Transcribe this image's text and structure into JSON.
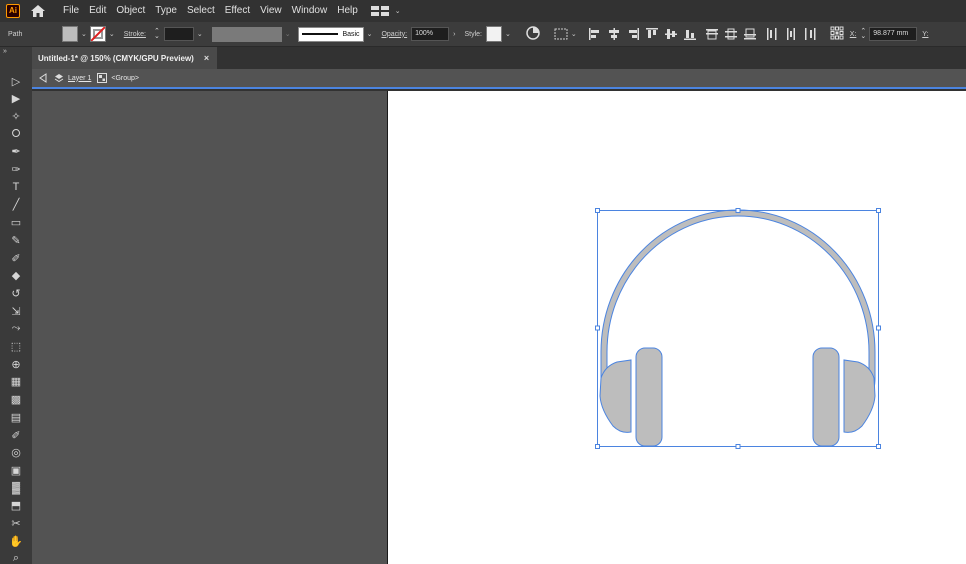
{
  "app": {
    "logo": "Ai"
  },
  "menu": [
    "File",
    "Edit",
    "Object",
    "Type",
    "Select",
    "Effect",
    "View",
    "Window",
    "Help"
  ],
  "control": {
    "selection_type": "Path",
    "stroke_label": "Stroke:",
    "brush_label": "Basic",
    "opacity_label": "Opacity:",
    "opacity_value": "100%",
    "style_label": "Style:",
    "x_label": "X:",
    "x_value": "98.877 mm",
    "y_label": "Y:"
  },
  "document": {
    "tab_title": "Untitled-1* @ 150% (CMYK/GPU Preview)",
    "close_glyph": "×"
  },
  "breadcrumb": {
    "layer": "Layer 1",
    "group": "<Group>"
  },
  "colors": {
    "fill": "#bdbdbd",
    "selection": "#4b84e0",
    "artboard": "#ffffff",
    "pasteboard": "#535353"
  },
  "tools": [
    "selection-tool-icon",
    "direct-selection-tool-icon",
    "magic-wand-tool-icon",
    "lasso-tool-icon",
    "pen-tool-icon",
    "curvature-tool-icon",
    "type-tool-icon",
    "line-segment-tool-icon",
    "rectangle-tool-icon",
    "paintbrush-tool-icon",
    "shaper-tool-icon",
    "eraser-tool-icon",
    "rotate-tool-icon",
    "scale-tool-icon",
    "warp-tool-icon",
    "free-transform-tool-icon",
    "shape-builder-tool-icon",
    "perspective-grid-tool-icon",
    "mesh-tool-icon",
    "gradient-tool-icon",
    "eyedropper-tool-icon",
    "blend-tool-icon",
    "symbol-sprayer-tool-icon",
    "column-graph-tool-icon",
    "artboard-tool-icon",
    "slice-tool-icon",
    "hand-tool-icon",
    "zoom-tool-icon"
  ]
}
